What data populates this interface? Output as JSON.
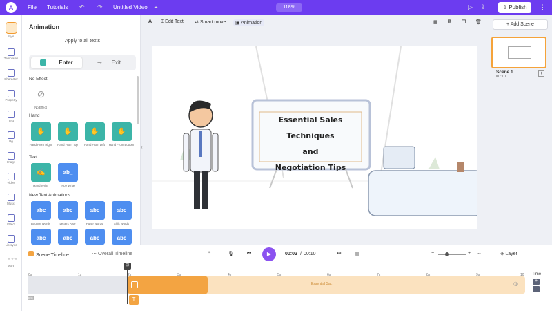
{
  "topbar": {
    "file": "File",
    "tutorials": "Tutorials",
    "title": "Untitled Video",
    "zoom": "118%",
    "publish": "Publish"
  },
  "rail": [
    "Style",
    "Templates",
    "Character",
    "Property",
    "Text",
    "Bg",
    "Image",
    "Video",
    "Music",
    "Effect",
    "Lip-sync",
    "More"
  ],
  "panel": {
    "title": "Animation",
    "apply": "Apply to all texts",
    "tabs": {
      "enter": "Enter",
      "exit": "Exit"
    },
    "no_effect_heading": "No Effect",
    "no_effect_label": "No Effect",
    "hand_heading": "Hand",
    "hand_items": [
      "Hand From Right",
      "Hand From Top",
      "Hand From Left",
      "Hand From Bottom"
    ],
    "text_heading": "Text",
    "text_items": [
      "Hand Write",
      "Type Write"
    ],
    "new_heading": "New Text Animations",
    "new_items": [
      "Bounce Words",
      "Letters Rise",
      "Pulse Words",
      "Shift Words"
    ],
    "card_glyphs": {
      "type": "ab_",
      "abc": "abc"
    }
  },
  "toolbar": {
    "edit_text": "Edit Text",
    "smart_move": "Smart move",
    "animation": "Animation"
  },
  "scene": {
    "line1": "Essential Sales Techniques",
    "line2": "and",
    "line3": "Negotiation Tips",
    "add_scene": "+ Add Scene",
    "scene_label": "Scene 1",
    "scene_time": "00:10"
  },
  "timeline": {
    "scene_tab": "Scene Timeline",
    "overall_tab": "Overall Timeline",
    "current": "00:02",
    "total": "00:10",
    "layer": "Layer",
    "track_label": "Essential Sa...",
    "time": "Time",
    "ruler": [
      "0s",
      "1s",
      "2s",
      "3s",
      "4s",
      "5s",
      "6s",
      "7s",
      "8s",
      "9s",
      "10"
    ]
  },
  "colors": {
    "accent": "#6c3cf0",
    "play": "#8b52f0",
    "track": "#f3a442",
    "teal": "#3cb5a8",
    "blue": "#4e8ef0"
  }
}
